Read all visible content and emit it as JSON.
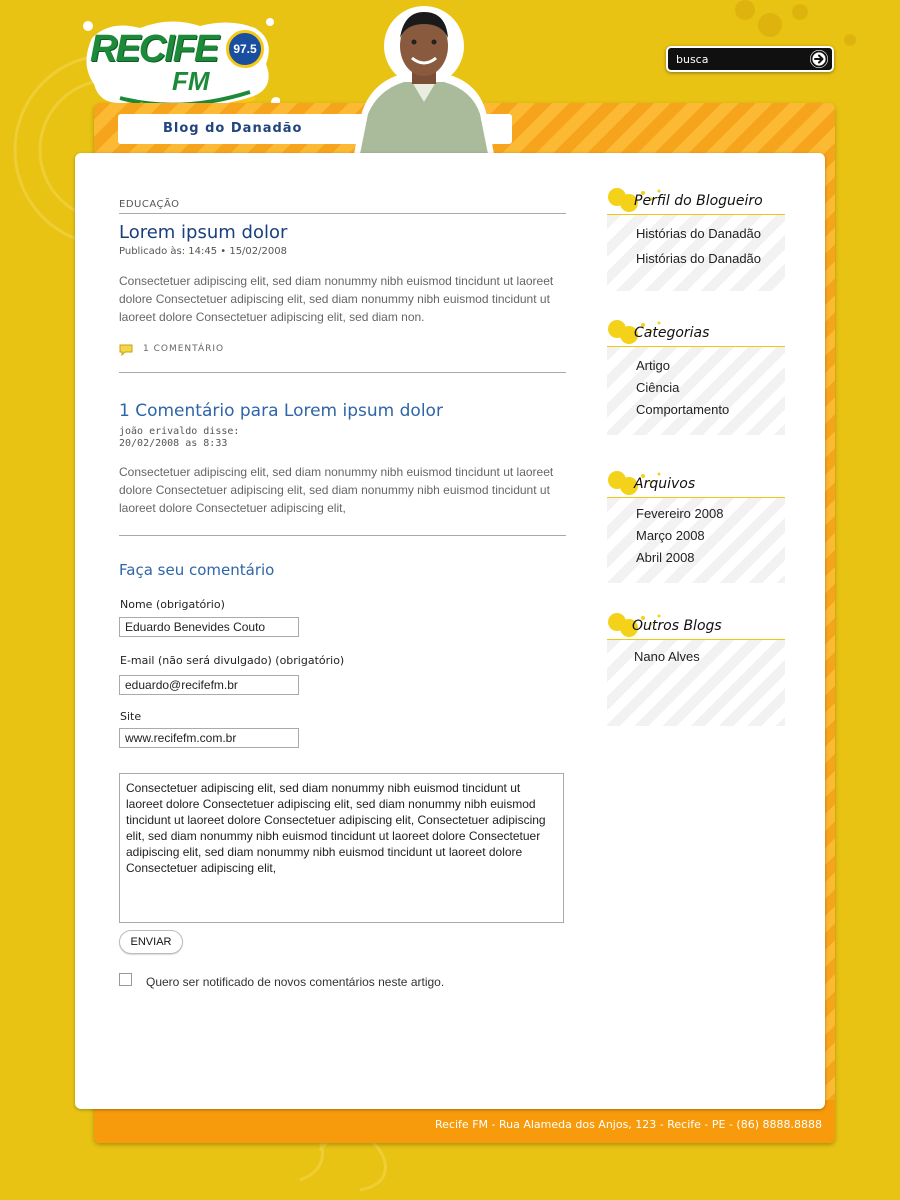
{
  "search": {
    "placeholder": "busca"
  },
  "header": {
    "logo_text": "RECIFE",
    "logo_fm": "FM",
    "logo_frequency": "97.5",
    "blog_title": "Blog do Danadão"
  },
  "post": {
    "category": "EDUCAÇÃO",
    "title": "Lorem ipsum dolor",
    "meta": "Publicado às: 14:45 • 15/02/2008",
    "body": "Consectetuer adipiscing elit, sed diam nonummy nibh euismod tincidunt ut laoreet dolore Consectetuer adipiscing elit, sed diam nonummy nibh euismod tincidunt ut laoreet dolore Consectetuer adipiscing elit, sed diam non.",
    "comment_count_label": "1 COMENTÁRIO"
  },
  "comments": {
    "title": "1 Comentário para Lorem ipsum dolor",
    "items": [
      {
        "author": "joão erivaldo disse:",
        "date": "20/02/2008 as 8:33",
        "text": "Consectetuer adipiscing elit, sed diam nonummy nibh euismod tincidunt ut laoreet dolore Consectetuer adipiscing elit, sed diam nonummy nibh euismod tincidunt ut laoreet dolore Consectetuer adipiscing elit,"
      }
    ]
  },
  "form": {
    "title": "Faça seu comentário",
    "name_label": "Nome (obrigatório)",
    "name_value": "Eduardo Benevides Couto",
    "email_label": "E-mail (não será divulgado) (obrigatório)",
    "email_value": "eduardo@recifefm.br",
    "site_label": "Site",
    "site_value": "www.recifefm.com.br",
    "message_value": "Consectetuer adipiscing elit, sed diam nonummy nibh euismod tincidunt ut laoreet dolore Consectetuer adipiscing elit, sed diam nonummy nibh euismod tincidunt ut laoreet dolore Consectetuer adipiscing elit, Consectetuer adipiscing elit, sed diam nonummy nibh euismod tincidunt ut laoreet dolore Consectetuer adipiscing elit, sed diam nonummy nibh euismod tincidunt ut laoreet dolore Consectetuer adipiscing elit,",
    "submit_label": "ENVIAR",
    "notify_label": "Quero ser notificado de novos comentários neste artigo.",
    "notify_checked": false
  },
  "sidebar": {
    "perfil": {
      "title": "Perfil do Blogueiro",
      "items": [
        "Histórias do Danadão",
        "Histórias do Danadão"
      ]
    },
    "categorias": {
      "title": "Categorias",
      "items": [
        "Artigo",
        "Ciência",
        "Comportamento"
      ]
    },
    "arquivos": {
      "title": "Arquivos",
      "items": [
        "Fevereiro 2008",
        "Março 2008",
        "Abril 2008"
      ]
    },
    "outros": {
      "title": "Outros Blogs",
      "items": [
        "Nano Alves"
      ]
    }
  },
  "footer": {
    "text": "Recife FM - Rua Alameda dos Anjos, 123 - Recife - PE - (86) 8888.8888"
  },
  "colors": {
    "background": "#e8c313",
    "band_orange": "#f7a41d",
    "title_blue": "#1a3f7e",
    "link_blue": "#2e65a8",
    "accent_yellow": "#f0c80f"
  },
  "icons": {
    "search": "arrow-right-circle-icon",
    "comment": "speech-bubble-icon"
  }
}
